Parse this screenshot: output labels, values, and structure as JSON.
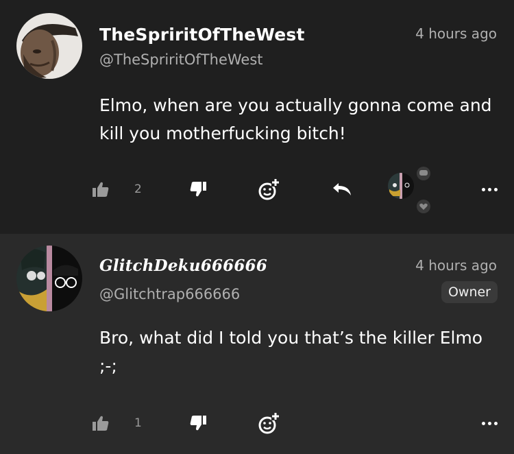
{
  "comments": [
    {
      "username": "TheSpriritOfTheWest",
      "handle": "@TheSpriritOfTheWest",
      "time": "4 hours ago",
      "text": "Elmo, when are you actually gonna come and kill you motherfucking bitch!",
      "like_count": "2",
      "avatar_icon": "old-man-portrait",
      "has_reply_button": true,
      "has_creator_reaction": true
    },
    {
      "username": "GlitchDeku666666",
      "handle": "@Glitchtrap666666",
      "time": "4 hours ago",
      "badge": "Owner",
      "text": "Bro, what did I told you that’s the killer Elmo ;-;",
      "like_count": "1",
      "avatar_icon": "anime-split-portrait",
      "has_reply_button": false,
      "has_creator_reaction": false
    }
  ],
  "colors": {
    "background": "#1f1f1f",
    "background_alt": "#2a2a2a",
    "muted_text": "#b0b0b0",
    "badge_bg": "#3a3a3a"
  },
  "icons": [
    "like-icon",
    "dislike-icon",
    "add-emoji-icon",
    "reply-icon",
    "more-icon"
  ]
}
